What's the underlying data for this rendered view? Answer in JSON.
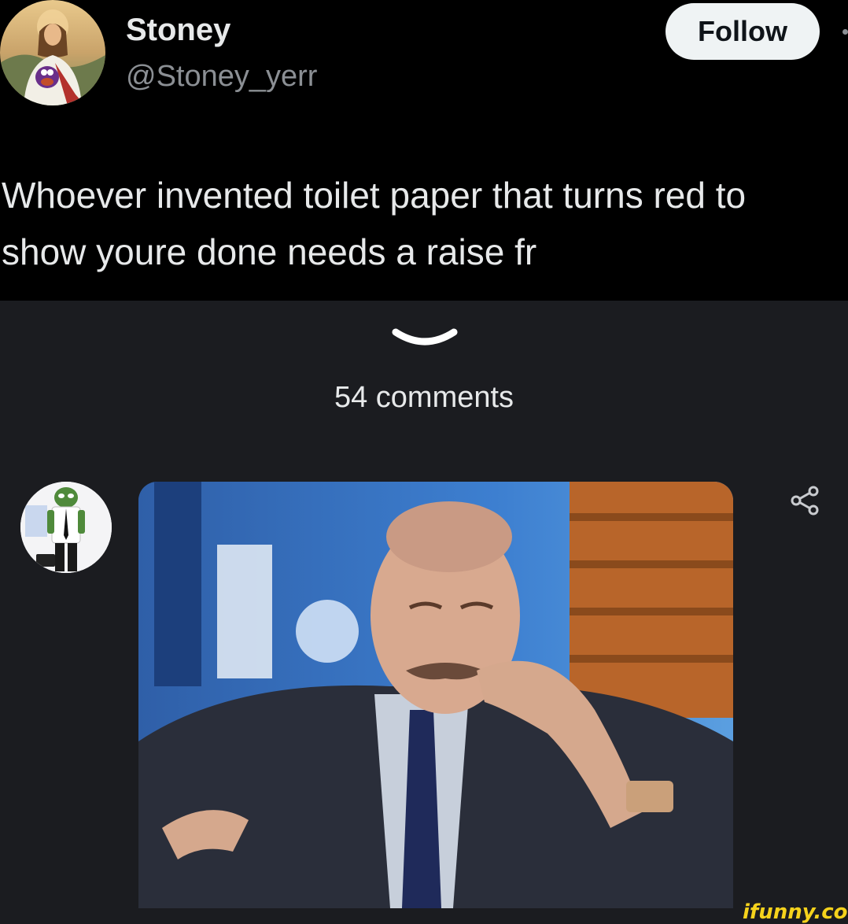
{
  "tweet": {
    "display_name": "Stoney",
    "handle": "@Stoney_yerr",
    "follow_label": "Follow",
    "text_lines": [
      "Whoever invented toilet paper that turns red to",
      "show youre done needs a raise fr"
    ],
    "avatar_icon": "jesus-painting-avatar-icon"
  },
  "comments": {
    "count_label": "54 comments",
    "collapse_icon": "chevron-down-icon",
    "share_icon": "share-icon",
    "commenter_avatar_icon": "pepe-frog-avatar-icon",
    "media_icon": "gif-image-icon"
  },
  "watermark": {
    "text": "ifunny.co"
  },
  "colors": {
    "background": "#000000",
    "panel": "#1b1c20",
    "text_primary": "#e7e9ea",
    "text_secondary": "#8b8f94",
    "follow_bg": "#eff3f4",
    "watermark": "#f5d21c"
  }
}
